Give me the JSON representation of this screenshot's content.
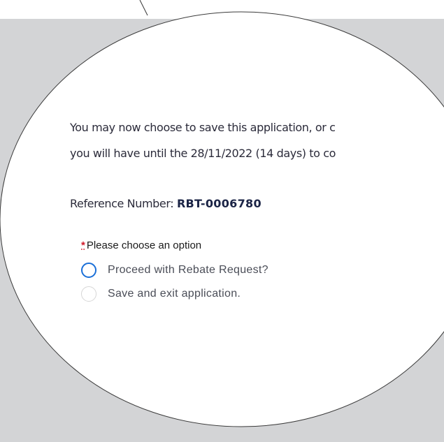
{
  "application": {
    "intro_line_1": "You may now choose to save this application, or c",
    "intro_line_2": "you will have until the 28/11/2022 (14 days) to co",
    "reference_label": "Reference Number:",
    "reference_number": "RBT-0006780"
  },
  "choice": {
    "required_marker": "*",
    "label": "Please choose an option",
    "options": [
      {
        "label": "Proceed with Rebate Request?",
        "focused": true,
        "checked": false
      },
      {
        "label": "Save and exit application.",
        "focused": false,
        "checked": false
      }
    ]
  },
  "colors": {
    "backdrop": "#d3d4d6",
    "focus_ring": "#1a6fd8",
    "required": "#d11a2a",
    "reference_text": "#1b2446"
  }
}
